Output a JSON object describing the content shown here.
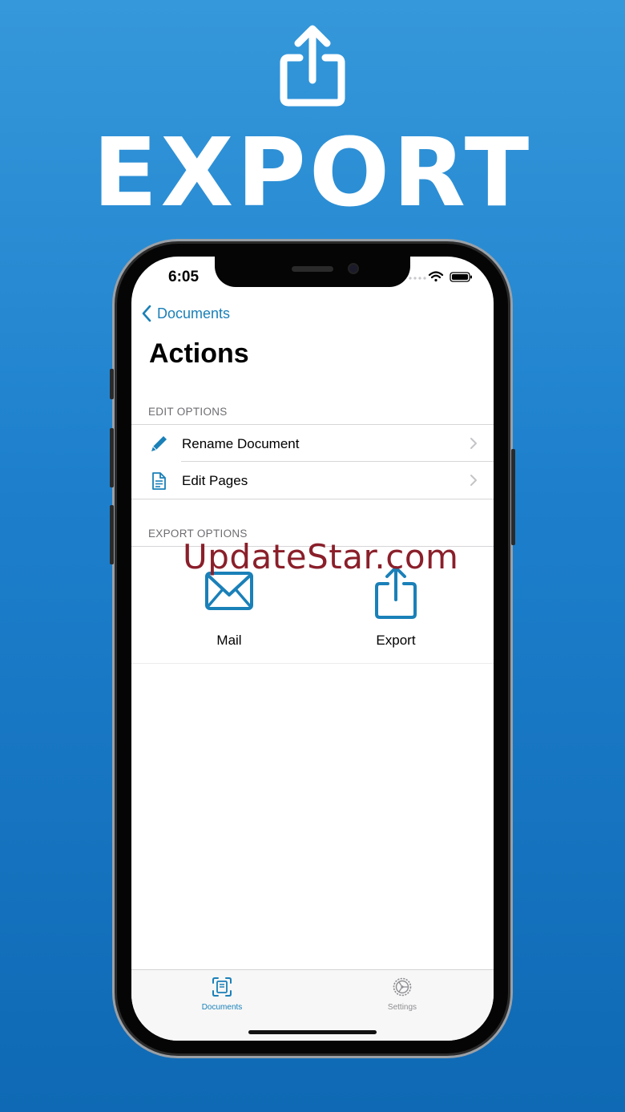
{
  "hero": {
    "title": "EXPORT",
    "icon": "share-icon"
  },
  "status_bar": {
    "time": "6:05"
  },
  "nav": {
    "back_label": "Documents",
    "title": "Actions"
  },
  "edit_options": {
    "header": "EDIT OPTIONS",
    "items": [
      {
        "label": "Rename Document",
        "icon": "pencil-icon"
      },
      {
        "label": "Edit Pages",
        "icon": "document-icon"
      }
    ]
  },
  "export_options": {
    "header": "EXPORT OPTIONS",
    "items": [
      {
        "label": "Mail",
        "icon": "mail-icon"
      },
      {
        "label": "Export",
        "icon": "share-icon"
      }
    ]
  },
  "watermark": "UpdateStar.com",
  "tab_bar": {
    "items": [
      {
        "label": "Documents",
        "icon": "scan-document-icon",
        "active": true
      },
      {
        "label": "Settings",
        "icon": "gear-icon",
        "active": false
      }
    ]
  },
  "colors": {
    "accent": "#1a80b8",
    "background_top": "#3598da",
    "background_bottom": "#0f69b4",
    "inactive_tab": "#8e8e93",
    "watermark": "#8a1f2a"
  }
}
